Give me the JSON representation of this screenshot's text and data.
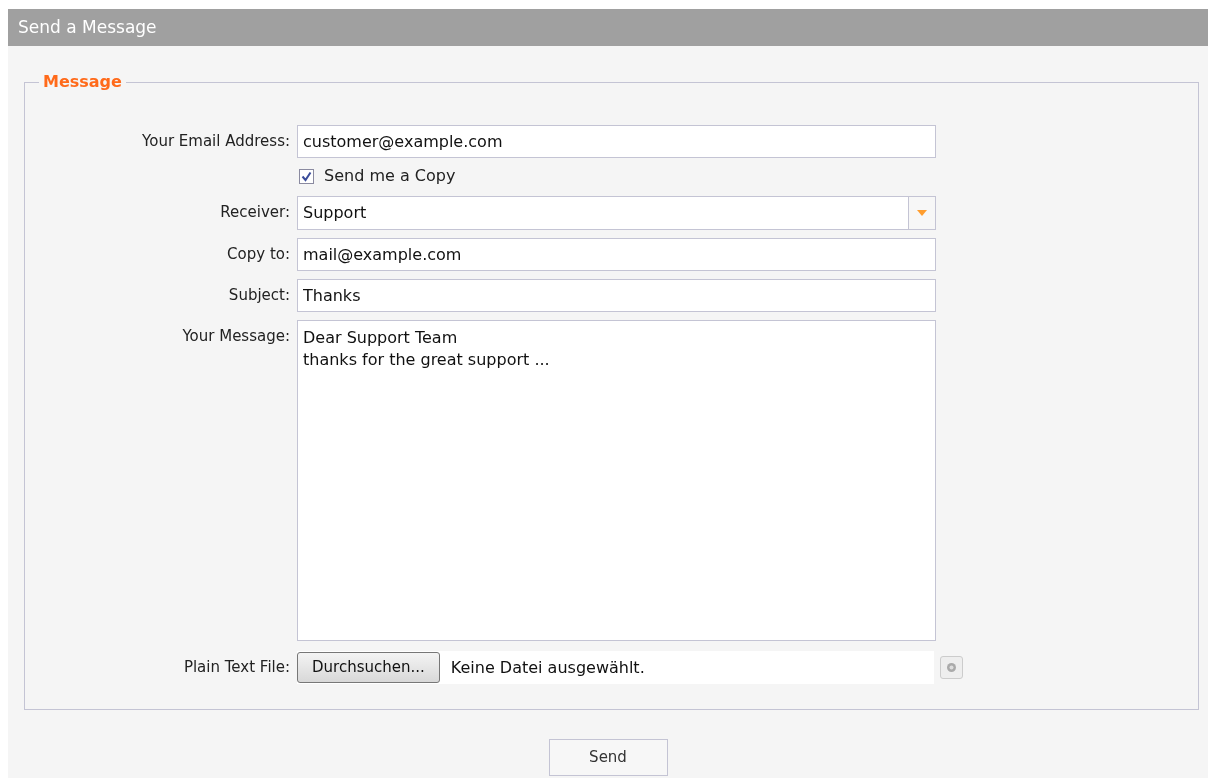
{
  "window": {
    "title": "Send a Message"
  },
  "fieldset": {
    "legend": "Message"
  },
  "fields": [
    {
      "kind": "text",
      "label": "Your Email Address:",
      "value": "customer@example.com"
    },
    {
      "kind": "checkbox",
      "label": "Send me a Copy",
      "checked": true
    },
    {
      "kind": "select",
      "label": "Receiver:",
      "value": "Support"
    },
    {
      "kind": "text",
      "label": "Copy to:",
      "value": "mail@example.com"
    },
    {
      "kind": "text",
      "label": "Subject:",
      "value": "Thanks"
    },
    {
      "kind": "textarea",
      "label": "Your Message:",
      "value": "Dear Support Team\nthanks for the great support ..."
    },
    {
      "kind": "file",
      "label": "Plain Text File:",
      "button": "Durchsuchen...",
      "status": "Keine Datei ausgewählt."
    }
  ],
  "buttons": [
    "Send"
  ]
}
